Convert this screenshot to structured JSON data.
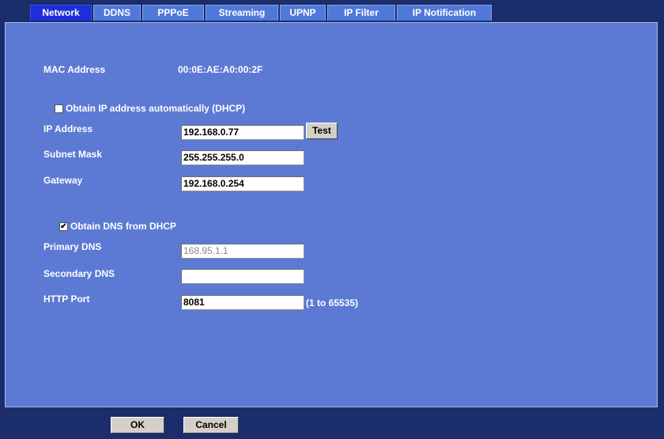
{
  "tabs": [
    {
      "label": "Network"
    },
    {
      "label": "DDNS"
    },
    {
      "label": "PPPoE"
    },
    {
      "label": "Streaming"
    },
    {
      "label": "UPNP"
    },
    {
      "label": "IP Filter"
    },
    {
      "label": "IP Notification"
    }
  ],
  "active_tab": "Network",
  "colors": {
    "panel_bg": "#5c7ad4",
    "page_bg": "#1b2d6b",
    "active_tab": "#1d2fd8",
    "tab": "#5078d8"
  },
  "mac": {
    "label": "MAC Address",
    "value": "00:0E:AE:A0:00:2F"
  },
  "dhcp": {
    "label": "Obtain IP address automatically (DHCP)",
    "checked": false,
    "mark": ""
  },
  "ip_address": {
    "label": "IP Address",
    "value": "192.168.0.77",
    "test_label": "Test"
  },
  "subnet_mask": {
    "label": "Subnet Mask",
    "value": "255.255.255.0"
  },
  "gateway": {
    "label": "Gateway",
    "value": "192.168.0.254"
  },
  "dns_dhcp": {
    "label": "Obtain DNS from DHCP",
    "checked": true,
    "mark": "✔"
  },
  "primary_dns": {
    "label": "Primary DNS",
    "value": "168.95.1.1",
    "disabled": true
  },
  "secondary_dns": {
    "label": "Secondary DNS",
    "value": ""
  },
  "http_port": {
    "label": "HTTP Port",
    "value": "8081",
    "hint": "(1 to 65535)"
  },
  "buttons": {
    "ok": "OK",
    "cancel": "Cancel"
  }
}
